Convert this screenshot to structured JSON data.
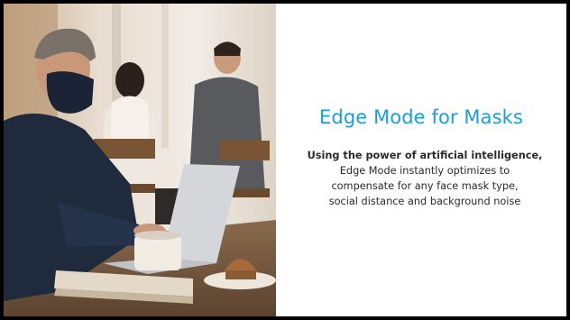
{
  "slide": {
    "title": "Edge Mode for Masks",
    "lead": "Using the power of artificial intelligence,",
    "body_lines": [
      "Edge Mode instantly optimizes to",
      "compensate for any face mask type,",
      "social distance and background noise"
    ]
  },
  "colors": {
    "title": "#1a9ed8",
    "body": "#2a2a2a",
    "frame": "#000000"
  }
}
